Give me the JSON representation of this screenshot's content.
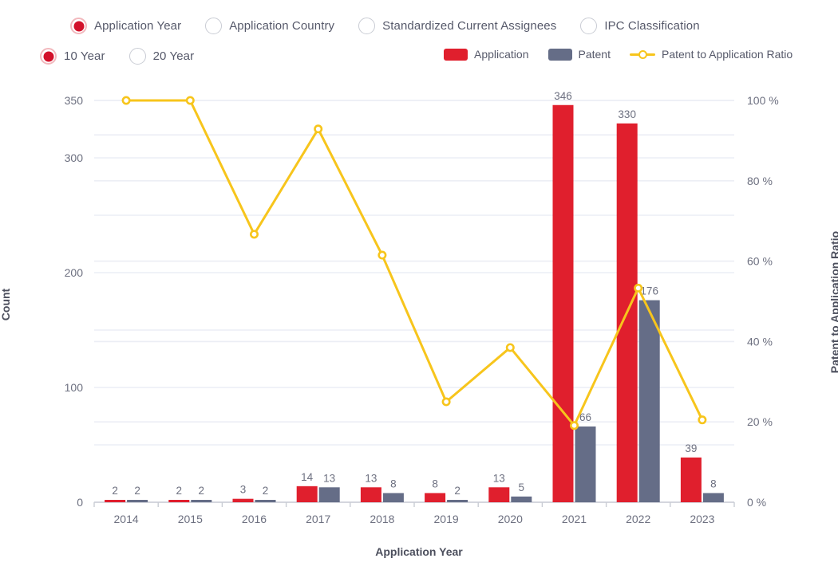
{
  "controls": {
    "category_group": {
      "name": "category-radio-group",
      "options": [
        {
          "label": "Application Year",
          "selected": true
        },
        {
          "label": "Application Country",
          "selected": false
        },
        {
          "label": "Standardized Current Assignees",
          "selected": false
        },
        {
          "label": "IPC Classification",
          "selected": false
        }
      ]
    },
    "range_group": {
      "name": "range-radio-group",
      "options": [
        {
          "label": "10 Year",
          "selected": true
        },
        {
          "label": "20 Year",
          "selected": false
        }
      ]
    }
  },
  "legend": {
    "items": [
      {
        "label": "Application",
        "type": "bar",
        "color": "#e01f2d"
      },
      {
        "label": "Patent",
        "type": "bar",
        "color": "#656d87"
      },
      {
        "label": "Patent to Application Ratio",
        "type": "line",
        "color": "#f7c51c"
      }
    ]
  },
  "colors": {
    "application": "#e01f2d",
    "patent": "#656d87",
    "ratio_line": "#f7c51c",
    "gridline": "#eceef5",
    "axis": "#c9ccd4",
    "text": "#6d7080",
    "selected_radio": "#d2112a"
  },
  "chart_data": {
    "type": "bar",
    "title": "",
    "xlabel": "Application Year",
    "ylabel": "Count",
    "y2label": "Patent to Application Ratio",
    "categories": [
      "2014",
      "2015",
      "2016",
      "2017",
      "2018",
      "2019",
      "2020",
      "2021",
      "2022",
      "2023"
    ],
    "ylim": [
      0,
      350
    ],
    "y_ticks": [
      0,
      100,
      200,
      300,
      350
    ],
    "y_tick_labels": [
      "0",
      "100",
      "200",
      "300",
      "350"
    ],
    "y_minor_ticks": [
      50,
      150,
      250,
      320
    ],
    "y2lim": [
      0,
      100
    ],
    "y2_ticks": [
      0,
      20,
      40,
      60,
      80,
      100
    ],
    "y2_tick_labels": [
      "0 %",
      "20 %",
      "40 %",
      "60 %",
      "80 %",
      "100 %"
    ],
    "grid": true,
    "legend_position": "top-right",
    "series": [
      {
        "name": "Application",
        "type": "bar",
        "axis": "left",
        "color": "#e01f2d",
        "values": [
          2,
          2,
          3,
          14,
          13,
          8,
          13,
          346,
          330,
          39
        ],
        "labels": [
          "2",
          "2",
          "3",
          "14",
          "13",
          "8",
          "13",
          "346",
          "330",
          "39"
        ]
      },
      {
        "name": "Patent",
        "type": "bar",
        "axis": "left",
        "color": "#656d87",
        "values": [
          2,
          2,
          2,
          13,
          8,
          2,
          5,
          66,
          176,
          8
        ],
        "labels": [
          "2",
          "2",
          "2",
          "13",
          "8",
          "2",
          "5",
          "66",
          "176",
          "8"
        ]
      },
      {
        "name": "Patent to Application Ratio",
        "type": "line",
        "axis": "right",
        "color": "#f7c51c",
        "values": [
          100,
          100,
          66.7,
          92.9,
          61.5,
          25,
          38.5,
          19.1,
          53.3,
          20.5
        ]
      }
    ]
  }
}
